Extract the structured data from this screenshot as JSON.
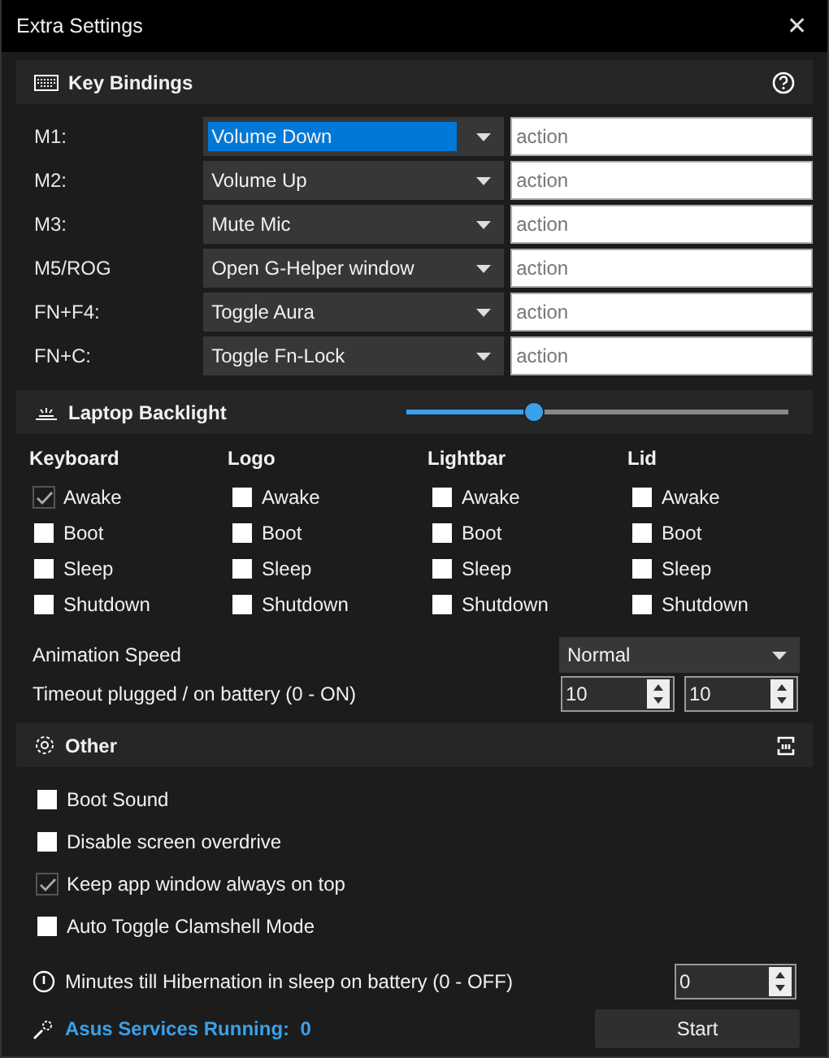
{
  "window": {
    "title": "Extra Settings",
    "close": "✕"
  },
  "key_bindings": {
    "title": "Key Bindings",
    "rows": [
      {
        "label": "M1:",
        "value": "Volume Down",
        "focused": true,
        "placeholder": "action"
      },
      {
        "label": "M2:",
        "value": "Volume Up",
        "focused": false,
        "placeholder": "action"
      },
      {
        "label": "M3:",
        "value": "Mute Mic",
        "focused": false,
        "placeholder": "action"
      },
      {
        "label": "M5/ROG",
        "value": "Open G-Helper window",
        "focused": false,
        "placeholder": "action"
      },
      {
        "label": "FN+F4:",
        "value": "Toggle Aura",
        "focused": false,
        "placeholder": "action"
      },
      {
        "label": "FN+C:",
        "value": "Toggle Fn-Lock",
        "focused": false,
        "placeholder": "action"
      }
    ]
  },
  "backlight": {
    "title": "Laptop Backlight",
    "level": 0.33,
    "columns": [
      {
        "title": "Keyboard",
        "options": [
          {
            "label": "Awake",
            "checked": true
          },
          {
            "label": "Boot",
            "checked": false
          },
          {
            "label": "Sleep",
            "checked": false
          },
          {
            "label": "Shutdown",
            "checked": false
          }
        ]
      },
      {
        "title": "Logo",
        "options": [
          {
            "label": "Awake",
            "checked": false
          },
          {
            "label": "Boot",
            "checked": false
          },
          {
            "label": "Sleep",
            "checked": false
          },
          {
            "label": "Shutdown",
            "checked": false
          }
        ]
      },
      {
        "title": "Lightbar",
        "options": [
          {
            "label": "Awake",
            "checked": false
          },
          {
            "label": "Boot",
            "checked": false
          },
          {
            "label": "Sleep",
            "checked": false
          },
          {
            "label": "Shutdown",
            "checked": false
          }
        ]
      },
      {
        "title": "Lid",
        "options": [
          {
            "label": "Awake",
            "checked": false
          },
          {
            "label": "Boot",
            "checked": false
          },
          {
            "label": "Sleep",
            "checked": false
          },
          {
            "label": "Shutdown",
            "checked": false
          }
        ]
      }
    ],
    "animation_speed": {
      "label": "Animation Speed",
      "value": "Normal"
    },
    "timeout": {
      "label": "Timeout plugged / on battery (0 - ON)",
      "plugged": "10",
      "battery": "10"
    }
  },
  "other": {
    "title": "Other",
    "options": [
      {
        "label": "Boot Sound",
        "checked": false
      },
      {
        "label": "Disable screen overdrive",
        "checked": false
      },
      {
        "label": "Keep app window always on top",
        "checked": true
      },
      {
        "label": "Auto Toggle Clamshell Mode",
        "checked": false
      }
    ],
    "hibernation": {
      "label": "Minutes till Hibernation in sleep on battery (0 - OFF)",
      "value": "0"
    },
    "services": {
      "label": "Asus Services Running:",
      "count": "0",
      "button": "Start"
    }
  }
}
